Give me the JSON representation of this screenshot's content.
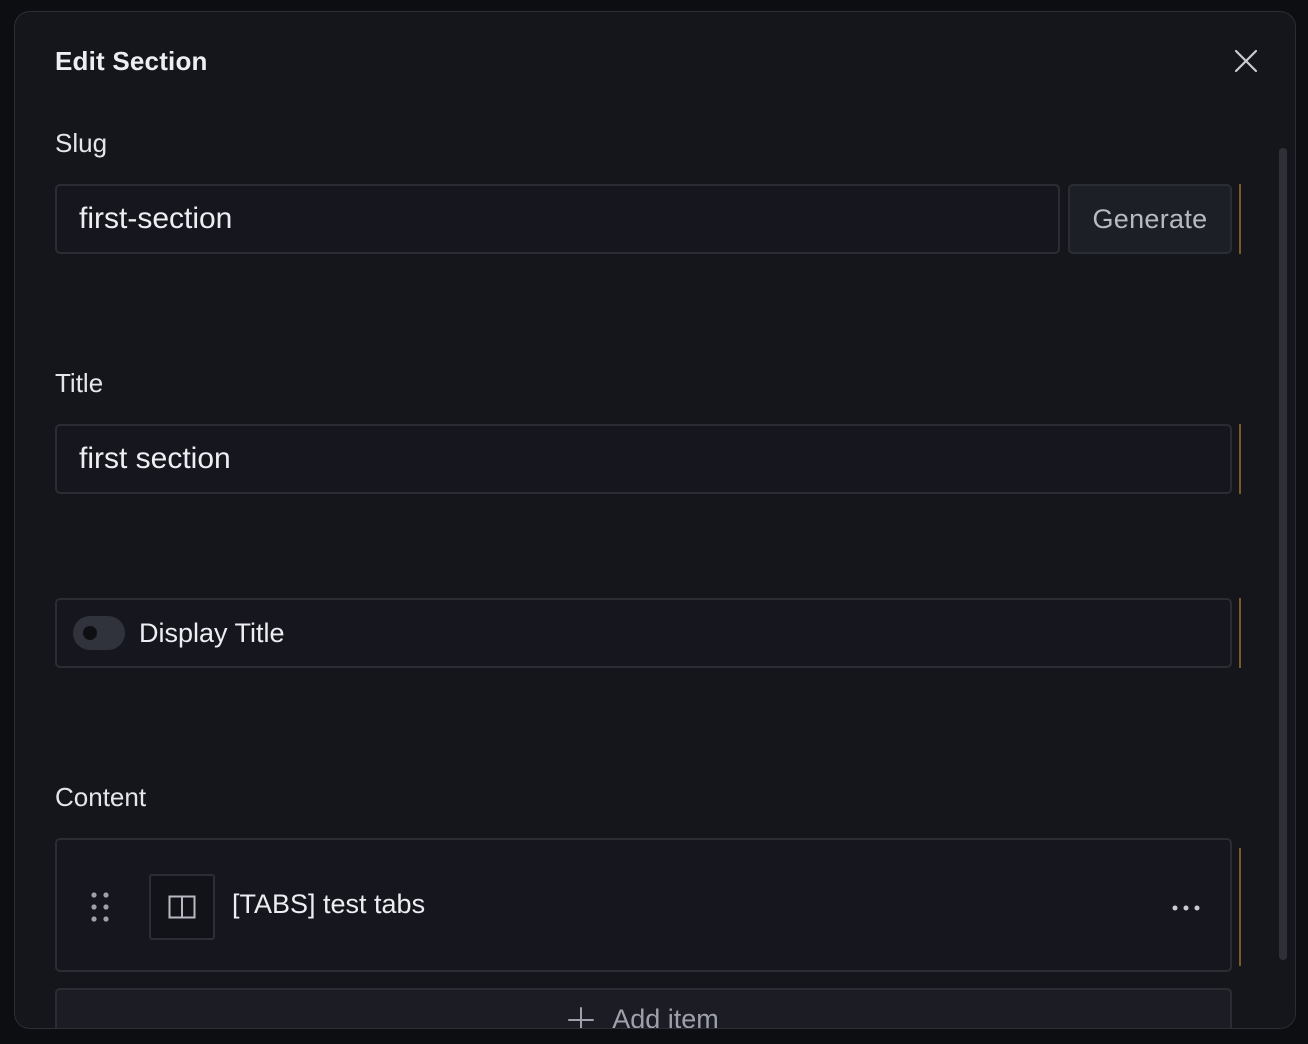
{
  "dialog": {
    "title": "Edit Section"
  },
  "fields": {
    "slug": {
      "label": "Slug",
      "value": "first-section",
      "generate_label": "Generate"
    },
    "title": {
      "label": "Title",
      "value": "first section"
    },
    "display_title": {
      "label": "Display Title",
      "enabled": false
    },
    "content": {
      "label": "Content",
      "items": [
        {
          "label": "[TABS] test tabs",
          "icon": "columns-icon"
        }
      ],
      "add_item_label": "Add item"
    }
  },
  "icons": {
    "close": "close-icon",
    "drag": "drag-handle-icon",
    "more": "more-horizontal-icon",
    "add": "plus-icon"
  },
  "colors": {
    "background": "#15161c",
    "input_border": "#2b2d35",
    "accent_bar": "#7a5a25",
    "text": "#eceef2",
    "muted_text": "#9ea1ab"
  }
}
